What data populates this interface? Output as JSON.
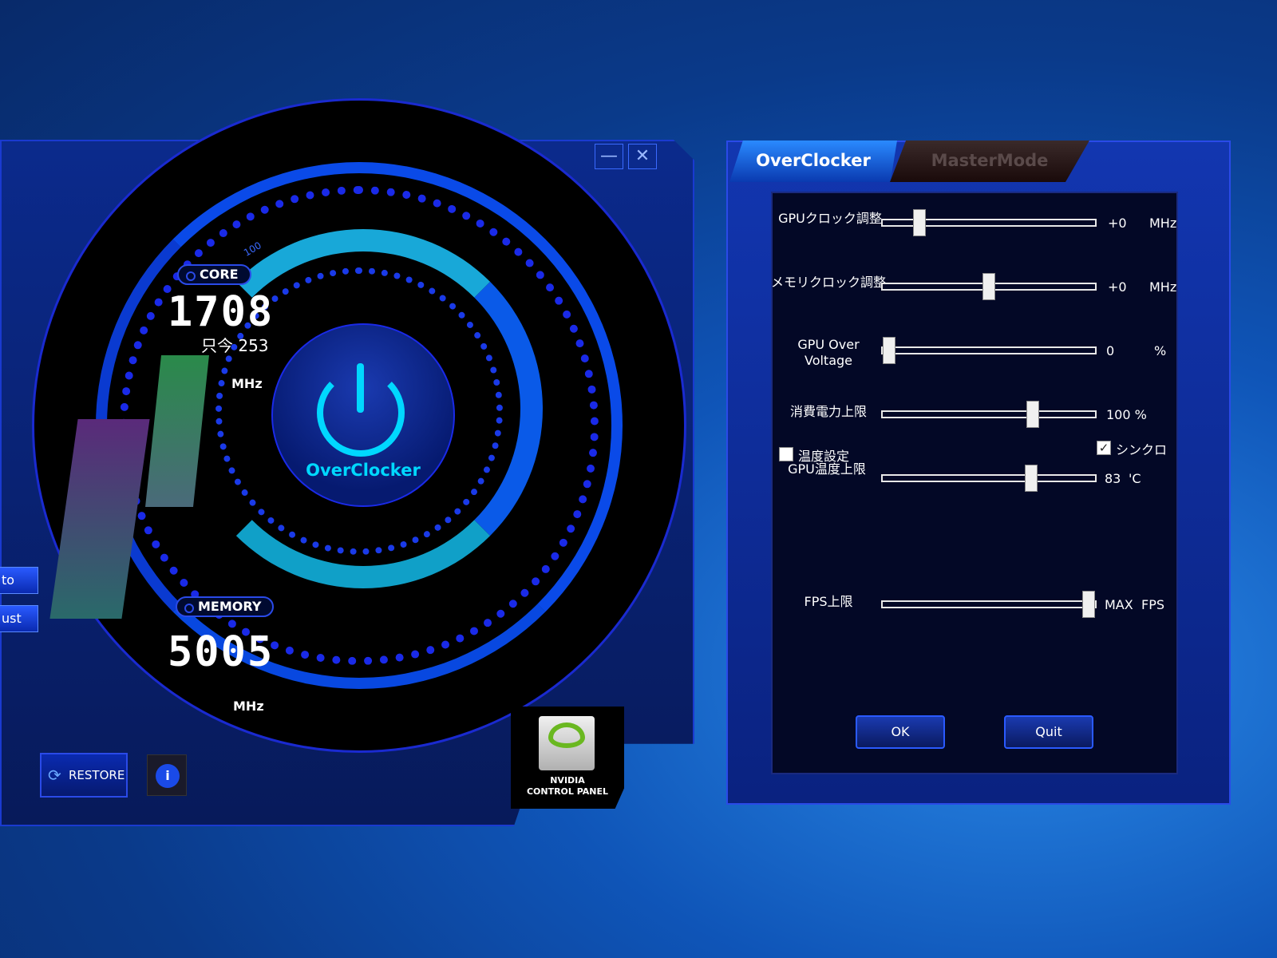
{
  "left_window": {
    "minimize_label": "—",
    "close_label": "✕",
    "core": {
      "label": "CORE",
      "value": "1708",
      "sub_label": "只今",
      "sub_value": "253",
      "unit": "MHz",
      "gauge_tick": "100"
    },
    "memory": {
      "label": "MEMORY",
      "value": "5005",
      "unit": "MHz"
    },
    "center_label": "OverClocker",
    "side_buttons": [
      "to",
      "ust"
    ],
    "restore_label": "RESTORE",
    "info_label": "i",
    "nvidia": {
      "line1": "NVIDIA",
      "line2": "CONTROL PANEL"
    }
  },
  "panel": {
    "tabs": [
      {
        "label": "OverClocker",
        "active": true
      },
      {
        "label": "MasterMode",
        "active": false
      }
    ],
    "sliders": [
      {
        "label": "GPUクロック調整",
        "value": "+0",
        "unit": "MHz",
        "position": 0.15
      },
      {
        "label": "メモリクロック調整",
        "value": "+0",
        "unit": "MHz",
        "position": 0.5
      },
      {
        "label": "GPU Over Voltage",
        "value": "0",
        "unit": "%",
        "position": 0.0
      },
      {
        "label": "消費電力上限",
        "value": "100 %",
        "unit": "",
        "position": 0.72
      },
      {
        "label": "GPU温度上限",
        "value": "83",
        "unit": "'C",
        "position": 0.71
      },
      {
        "label": "FPS上限",
        "value": "MAX",
        "unit": "FPS",
        "position": 1.0
      }
    ],
    "temp_setting": {
      "label": "温度設定",
      "checked": false
    },
    "sync": {
      "label": "シンクロ",
      "checked": true
    },
    "ok_label": "OK",
    "quit_label": "Quit"
  },
  "colors": {
    "accent": "#00d8ff",
    "frame": "#1a3ad0",
    "panel_bg": "#030826"
  }
}
